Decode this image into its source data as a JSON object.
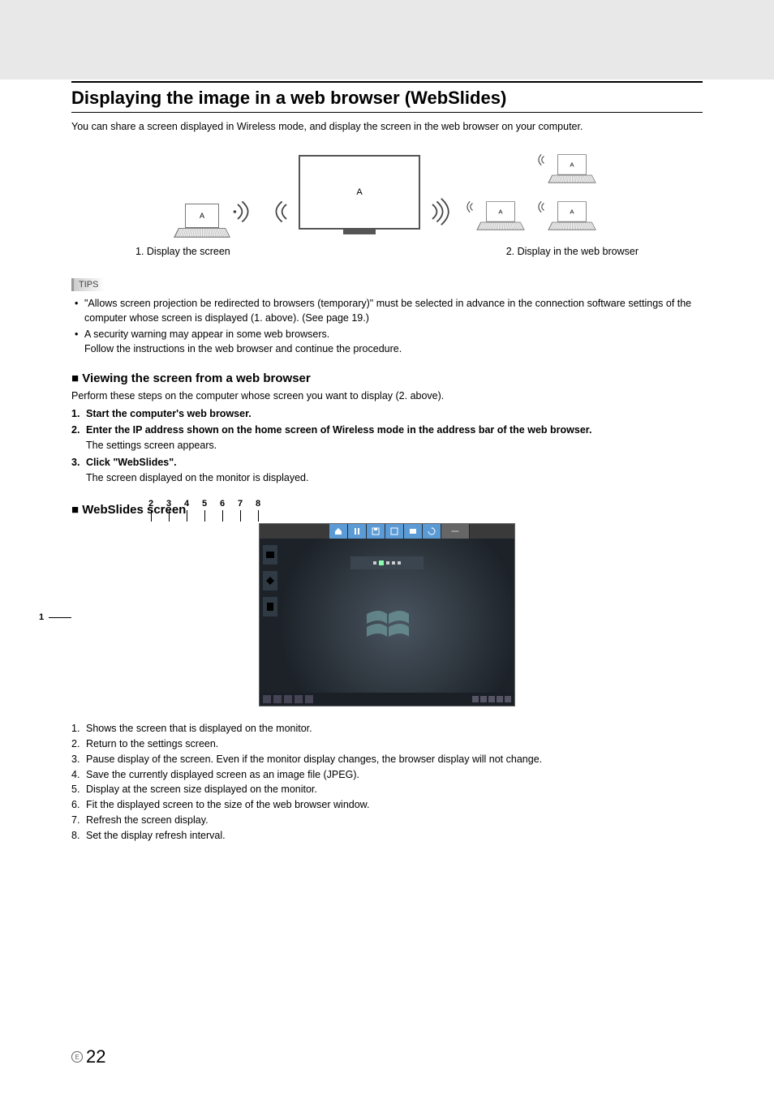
{
  "section_title": "Displaying the image in a web browser (WebSlides)",
  "intro": "You can share a screen displayed in Wireless mode, and display the screen in the web browser on your computer.",
  "diagram": {
    "letter": "A",
    "caption_left": "1. Display the screen",
    "caption_right": "2. Display in the web browser"
  },
  "tips_label": "TIPS",
  "tips": [
    "\"Allows screen projection be redirected to browsers (temporary)\" must be selected in advance in the connection software settings of the computer whose screen is displayed (1. above). (See page 19.)",
    "A security warning may appear in some web browsers.\nFollow the instructions in the web browser and continue the procedure."
  ],
  "subhead1": "Viewing the screen from a web browser",
  "subhead1_intro": "Perform these steps on the computer whose screen you want to display (2. above).",
  "steps": [
    {
      "title": "Start the computer's web browser.",
      "desc": ""
    },
    {
      "title": "Enter the IP address shown on the home screen of Wireless mode in the address bar of the web browser.",
      "desc": "The settings screen appears."
    },
    {
      "title": "Click \"WebSlides\".",
      "desc": "The screen displayed on the monitor is displayed."
    }
  ],
  "subhead2": "WebSlides screen",
  "callouts": {
    "left": "1",
    "top": [
      "2",
      "3",
      "4",
      "5",
      "6",
      "7",
      "8"
    ]
  },
  "legend": [
    "Shows the screen that is displayed on the monitor.",
    "Return to the settings screen.",
    "Pause display of the screen. Even if the monitor display changes, the browser display will not change.",
    "Save the currently displayed screen as an image file (JPEG).",
    "Display at the screen size displayed on the monitor.",
    "Fit the displayed screen to the size of the web browser window.",
    "Refresh the screen display.",
    "Set the display refresh interval."
  ],
  "page_marker": "E",
  "page_number": "22"
}
